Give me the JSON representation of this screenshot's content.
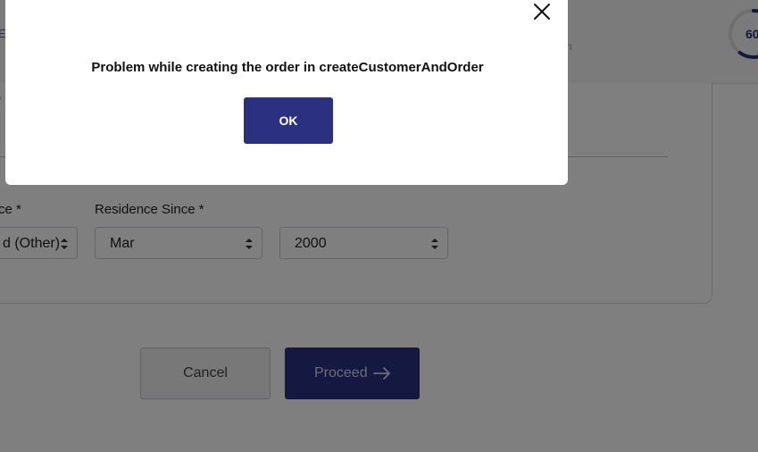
{
  "header": {
    "link_text": "E",
    "step_hint": "n",
    "progress_text": "60",
    "progress_fraction": 0.6
  },
  "form": {
    "cut_value": ")",
    "residence_type": {
      "label": "ce *",
      "value": "d (Other)"
    },
    "residence_since": {
      "label": "Residence Since *",
      "month_value": "Mar",
      "year_value": "2000"
    }
  },
  "actions": {
    "cancel_label": "Cancel",
    "proceed_label": "Proceed"
  },
  "dialog": {
    "message": "Problem while creating the order in createCustomerAndOrder",
    "ok_label": "OK"
  },
  "colors": {
    "primary": "#2b3180",
    "overlay": "rgba(0,0,0,0.5)"
  }
}
